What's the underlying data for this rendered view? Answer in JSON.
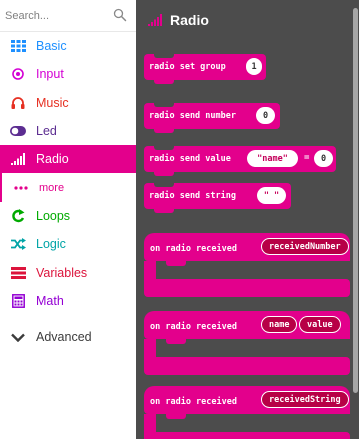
{
  "search": {
    "placeholder": "Search..."
  },
  "categories": [
    {
      "label": "Basic",
      "color": "#1e90ff",
      "icon": "grid-icon"
    },
    {
      "label": "Input",
      "color": "#d400d4",
      "icon": "target-icon"
    },
    {
      "label": "Music",
      "color": "#e63022",
      "icon": "headphones-icon"
    },
    {
      "label": "Led",
      "color": "#5c2d91",
      "icon": "toggle-icon"
    },
    {
      "label": "Radio",
      "color": "#e3008c",
      "icon": "signal-bars-icon"
    },
    {
      "label": "more",
      "color": "#e3008c",
      "icon": "dots-icon"
    },
    {
      "label": "Loops",
      "color": "#00aa00",
      "icon": "loop-arrow-icon"
    },
    {
      "label": "Logic",
      "color": "#00a4a6",
      "icon": "shuffle-icon"
    },
    {
      "label": "Variables",
      "color": "#dc143c",
      "icon": "lines-icon"
    },
    {
      "label": "Math",
      "color": "#9400d3",
      "icon": "calculator-icon"
    },
    {
      "label": "Advanced",
      "color": "#3c3c3c",
      "icon": "chevron-down-icon"
    }
  ],
  "flyout": {
    "title": "Radio",
    "blocks": {
      "set_group": {
        "text": "radio set group",
        "value": "1"
      },
      "send_number": {
        "text": "radio send number",
        "value": "0"
      },
      "send_value": {
        "text": "radio send value",
        "name": "\"name\"",
        "eq": "=",
        "value": "0"
      },
      "send_string": {
        "text": "radio send string",
        "value": "\" \""
      },
      "received_number": {
        "text": "on radio received",
        "var": "receivedNumber"
      },
      "received_name_value": {
        "text": "on radio received",
        "var1": "name",
        "var2": "value"
      },
      "received_string": {
        "text": "on radio received",
        "var": "receivedString"
      }
    }
  },
  "colors": {
    "accent": "#e3008c",
    "flyout_bg": "#4c4c4c"
  }
}
